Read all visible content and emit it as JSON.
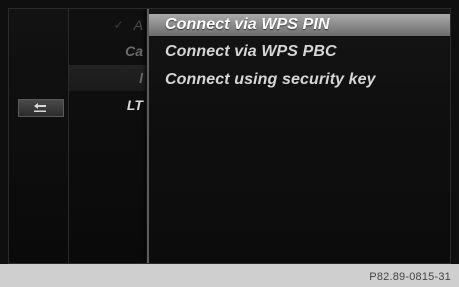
{
  "back_button": {
    "icon": "back-arrow-icon"
  },
  "background_list": {
    "items": [
      {
        "label": "A"
      },
      {
        "label": "Ca"
      },
      {
        "label": "l"
      },
      {
        "label": "LT"
      }
    ]
  },
  "menu": {
    "items": [
      {
        "label": "Connect via WPS PIN",
        "selected": true
      },
      {
        "label": "Connect via WPS PBC",
        "selected": false
      },
      {
        "label": "Connect using security key",
        "selected": false
      }
    ]
  },
  "footer": {
    "reference_code": "P82.89-0815-31"
  },
  "colors": {
    "highlight": "#9a9a9a",
    "text": "#d6d6d6",
    "background": "#0c0c0c"
  }
}
